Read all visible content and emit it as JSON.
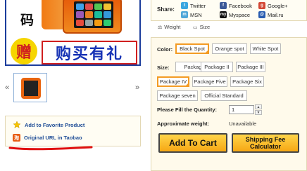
{
  "product_image": {
    "char_top": "码",
    "gift_char": "赠",
    "promo_text": "购买有礼"
  },
  "thumbnails": {
    "prev_icon": "«",
    "next_icon": "»"
  },
  "favorites": {
    "add_label": "Add to Favorite Product",
    "original_url_label": "Original URL in Taobao"
  },
  "share": {
    "label": "Share:",
    "items": [
      {
        "name": "Twitter",
        "icon": "twitter-icon",
        "color": "#3aa7e0"
      },
      {
        "name": "Facebook",
        "icon": "facebook-icon",
        "color": "#3b5998"
      },
      {
        "name": "Google+",
        "icon": "googleplus-icon",
        "color": "#d34836"
      },
      {
        "name": "MSN",
        "icon": "msn-icon",
        "color": "#4fa7d8"
      },
      {
        "name": "Myspace",
        "icon": "myspace-icon",
        "color": "#111111"
      },
      {
        "name": "Mail.ru",
        "icon": "mailru-icon",
        "color": "#2a5db0"
      }
    ]
  },
  "tabs": [
    {
      "label": "Weight",
      "icon": "weight-icon"
    },
    {
      "label": "Size",
      "icon": "ruler-icon"
    }
  ],
  "options": {
    "color_label": "Color:",
    "colors": [
      "Black Spot",
      "Orange spot",
      "White Spot"
    ],
    "selected_color": "Black Spot",
    "size_label": "Size:",
    "packages": [
      "Package I",
      "Package II",
      "Package III",
      "Package IV",
      "Package Five",
      "Package Six",
      "Package seven",
      "Official Standard"
    ],
    "selected_package": "Package IV",
    "quantity_label": "Please Fill the Quantity:",
    "quantity_value": "1",
    "weight_label": "Approximate weight:",
    "weight_value": "Unavailable"
  },
  "buttons": {
    "add_to_cart": "Add To Cart",
    "shipping_fee_line1": "Shipping Fee",
    "shipping_fee_line2": "Calculator"
  },
  "colors": {
    "accent_orange": "#f39b23",
    "panel_bg": "#fffaeb",
    "link_blue": "#1f4d96",
    "scribble_red": "#e01010"
  }
}
